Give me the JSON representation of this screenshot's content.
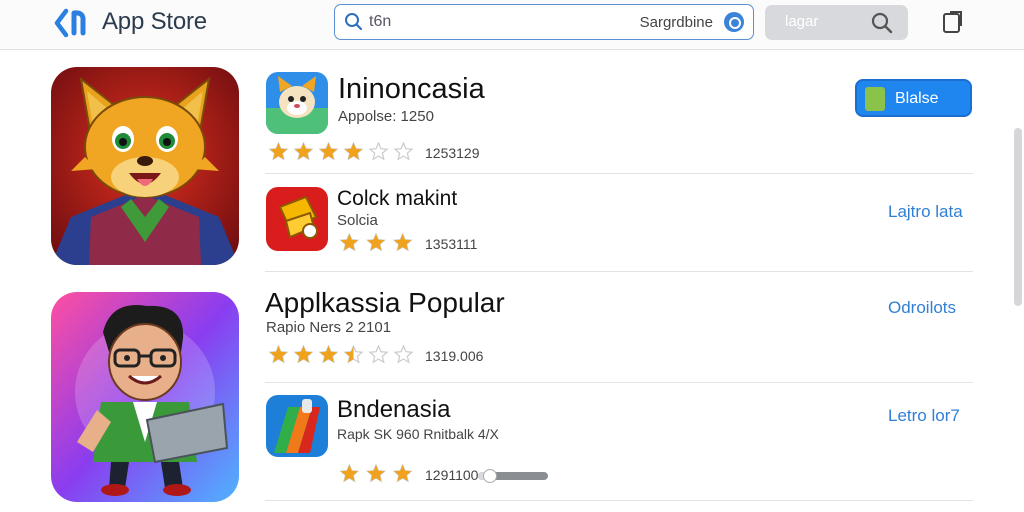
{
  "header": {
    "title": "App Store",
    "search": {
      "value": "",
      "placeholder": "t6n",
      "suggestion": "Sargrdbine"
    },
    "login_label": "lagar"
  },
  "featured": [
    {
      "name": "fox-app-icon"
    },
    {
      "name": "developer-app-icon"
    }
  ],
  "apps": [
    {
      "name": "Ininoncasia",
      "subtitle": "Appolse: 1250",
      "rating": 4,
      "rating_count": "1253129",
      "action": "Blalse"
    },
    {
      "name": "Colck makint",
      "subtitle": "Solcia",
      "rating": 3.5,
      "rating_count": "1353111",
      "action": "Lajtro lata"
    },
    {
      "name": "Applkassia Popular",
      "subtitle": "Rapio Ners 2 2101",
      "rating": 3.5,
      "rating_count": "1319.006",
      "action": "Odroilots"
    },
    {
      "name": "Bndenasia",
      "subtitle": "Rapk  SK  960  Rnitbalk 4/X",
      "rating": 3.5,
      "rating_count": "1291100",
      "action": "Letro lor7",
      "download_progress": 0.15
    }
  ],
  "colors": {
    "accent": "#1f86f0",
    "link": "#2f7fd6",
    "star": "#f0a21c",
    "star_empty": "#c9cbcf"
  }
}
